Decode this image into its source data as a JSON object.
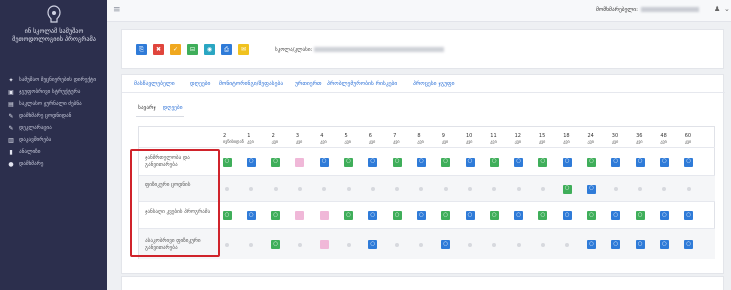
{
  "sidebar": {
    "brand": "ინ სკოლამ სამუშაო მეთოდოლოგიის პროგრამა",
    "items": [
      {
        "icon": "pin-icon",
        "label": "სამუშაო მეცნიერების დირექტი"
      },
      {
        "icon": "table-icon",
        "label": "ჯგუფობრივი სტრუქტურა"
      },
      {
        "icon": "calendar-icon",
        "label": "საკლასო ჟურნალი ძებნა"
      },
      {
        "icon": "edit-icon",
        "label": "დამხმარე ცოდნიდან"
      },
      {
        "icon": "edit-icon",
        "label": "დეკლარაცია"
      },
      {
        "icon": "chart-icon",
        "label": "დაკავშირება"
      },
      {
        "icon": "bar-icon",
        "label": "ანალიზი"
      },
      {
        "icon": "info-icon",
        "label": "დამხმარე"
      }
    ]
  },
  "topbar": {
    "menu_icon": "≡",
    "user_label": "მომხმარებელი:",
    "user_icon": "♟",
    "caret": "⌄"
  },
  "toolbar": {
    "buttons": [
      {
        "name": "save-button",
        "glyph": "⎘",
        "color": "#2f7bd8"
      },
      {
        "name": "delete-button",
        "glyph": "✖",
        "color": "#e0453c"
      },
      {
        "name": "check-button",
        "glyph": "✓",
        "color": "#f0a81f"
      },
      {
        "name": "export-button",
        "glyph": "⊟",
        "color": "#3fae5a"
      },
      {
        "name": "camera-button",
        "glyph": "◉",
        "color": "#2aa6c2"
      },
      {
        "name": "print-button",
        "glyph": "⎙",
        "color": "#2f7bd8"
      },
      {
        "name": "mail-button",
        "glyph": "✉",
        "color": "#f0c21f"
      }
    ],
    "school_label": "სკოლა/კლასი:"
  },
  "tabs": [
    "მასწავლებელი",
    "დღეები",
    "მონიტორინგი/შეფასება",
    "ურთიერთ",
    "პრობლემურობის რისკები",
    "პროცესი ჯგუფი"
  ],
  "subtabs": {
    "active": "სავარჯ",
    "other": "დღეები"
  },
  "table": {
    "columns": [
      {
        "num": "2",
        "sub": "ივნისიდან"
      },
      {
        "num": "1",
        "sub": "კვი"
      },
      {
        "num": "2",
        "sub": "კვი"
      },
      {
        "num": "3",
        "sub": "კვი"
      },
      {
        "num": "4",
        "sub": "კვი"
      },
      {
        "num": "5",
        "sub": "კვი"
      },
      {
        "num": "6",
        "sub": "კვი"
      },
      {
        "num": "7",
        "sub": "კვი"
      },
      {
        "num": "8",
        "sub": "კვი"
      },
      {
        "num": "9",
        "sub": "კვი"
      },
      {
        "num": "10",
        "sub": "კვი"
      },
      {
        "num": "11",
        "sub": "კვი"
      },
      {
        "num": "12",
        "sub": "კვი"
      },
      {
        "num": "15",
        "sub": "კვი"
      },
      {
        "num": "18",
        "sub": "კვი"
      },
      {
        "num": "24",
        "sub": "კვი"
      },
      {
        "num": "30",
        "sub": "კვი"
      },
      {
        "num": "36",
        "sub": "კვი"
      },
      {
        "num": "48",
        "sub": "კვი"
      },
      {
        "num": "60",
        "sub": "კვი"
      }
    ],
    "rows": [
      {
        "label": "ჯანმრთელობა და განვითარება",
        "cells": [
          "G",
          "B",
          "G",
          "P",
          "B",
          "G",
          "B",
          "G",
          "B",
          "G",
          "B",
          "G",
          "B",
          "G",
          "B",
          "G",
          "B",
          "B",
          "B",
          "B"
        ]
      },
      {
        "label": "ფიზიკური ცოდნის",
        "cells": [
          "-",
          "-",
          "-",
          "-",
          "-",
          "-",
          "-",
          "-",
          "-",
          "-",
          "-",
          "-",
          "-",
          "-",
          "G",
          "B",
          "-",
          "-",
          "-",
          "-"
        ]
      },
      {
        "label": "ჯანსაღი კვების პროგრამა",
        "cells": [
          "G",
          "B",
          "G",
          "P",
          "P",
          "G",
          "B",
          "G",
          "B",
          "G",
          "B",
          "G",
          "B",
          "G",
          "B",
          "G",
          "B",
          "G",
          "B",
          "B"
        ]
      },
      {
        "label": "ასაკობრივი ფიზიკური განვითარება",
        "cells": [
          "-",
          "-",
          "G",
          "-",
          "P",
          "-",
          "B",
          "-",
          "-",
          "B",
          "-",
          "-",
          "-",
          "-",
          "-",
          "B",
          "B",
          "B",
          "B",
          "B"
        ]
      }
    ]
  },
  "colors": {
    "green": "#3fae5a",
    "blue": "#2f7bd8",
    "pink": "#f0b8d8",
    "highlight": "#d0232b"
  }
}
